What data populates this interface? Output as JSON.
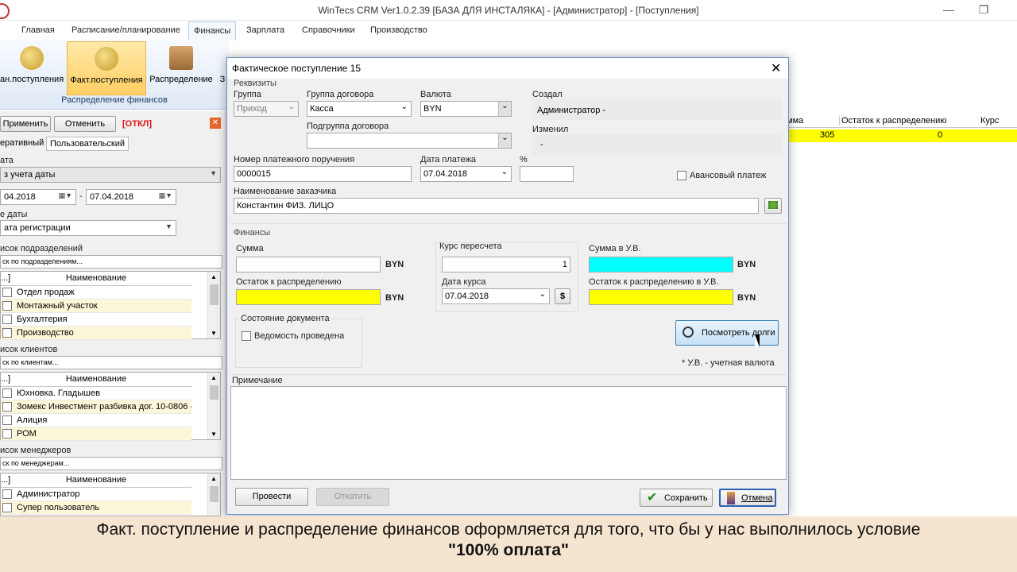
{
  "window": {
    "title": "WinTecs CRM Ver1.0.2.39 [БАЗА ДЛЯ ИНСТАЛЯКА] - [Администратор]  - [Поступления]"
  },
  "ribbon": {
    "tabs": [
      "Главная",
      "Расписание/планирование",
      "Финансы",
      "Зарплата",
      "Справочники",
      "Производство"
    ],
    "buttons": [
      "ан.поступления",
      "Факт.поступления",
      "Распределение",
      "З"
    ],
    "group_label": "Распределение финансов"
  },
  "left_panel": {
    "apply": "Применить",
    "cancel": "Отменить",
    "status": "[ОТКЛ]",
    "tabs": [
      "еративный",
      "Пользовательский"
    ],
    "date_section_label": "ата",
    "date_mode": "з учета даты",
    "date_from": "04.2018",
    "date_sep": "-",
    "date_to": "07.04.2018",
    "date_type_label": "е даты",
    "date_type": "ата регистрации",
    "departments": {
      "title": "исок подразделений",
      "search": "ск по подразделениям...",
      "col_check": "...]",
      "col_name": "Наименование",
      "rows": [
        "Отдел продаж",
        "Монтажный участок",
        "Бухгалтерия",
        "Производство"
      ]
    },
    "clients": {
      "title": "исок клиентов",
      "search": "ск по клиентам...",
      "col_check": "...]",
      "col_name": "Наименование",
      "rows": [
        "Юхновка. Гладышев",
        "Зомекс Инвестмент разбивка дог. 10-0806 -",
        "Алиция",
        "РОМ"
      ]
    },
    "managers": {
      "title": "исок менеджеров",
      "search": "ск по менеджерам...",
      "col_check": "...]",
      "col_name": "Наименование",
      "rows": [
        "Администратор",
        "Супер пользователь"
      ]
    }
  },
  "right_grid": {
    "headers": [
      "мма",
      "Остаток к распределению",
      "Курс"
    ],
    "row": [
      "305",
      "0",
      ""
    ]
  },
  "dialog": {
    "title": "Фактическое поступление 15",
    "requisites_label": "Реквизиты",
    "group_label": "Группа",
    "group_value": "Приход",
    "contract_group_label": "Группа договора",
    "contract_group_value": "Касса",
    "currency_label": "Валюта",
    "currency_value": "BYN",
    "created_label": "Создал",
    "created_value": "Администратор -",
    "contract_subgroup_label": "Подгруппа договора",
    "contract_subgroup_value": "",
    "changed_label": "Изменил",
    "changed_value": "-",
    "order_number_label": "Номер платежного поручения",
    "order_number_value": "0000015",
    "pay_date_label": "Дата платежа",
    "pay_date_value": "07.04.2018",
    "percent_label": "%",
    "percent_value": "",
    "advance_label": "Авансовый платеж",
    "customer_label": "Наименование заказчика",
    "customer_value": "Константин ФИЗ. ЛИЦО",
    "finance_label": "Финансы",
    "sum_label": "Сумма",
    "sum_value": "",
    "sum_currency": "BYN",
    "remain_label": "Остаток к распределению",
    "remain_value": "",
    "remain_currency": "BYN",
    "rate_label": "Курс пересчета",
    "rate_value": "1",
    "rate_date_label": "Дата курса",
    "rate_date_value": "07.04.2018",
    "rate_button": "$",
    "sum_uv_label": "Сумма в У.В.",
    "sum_uv_value": "",
    "sum_uv_currency": "BYN",
    "remain_uv_label": "Остаток к распределению в У.В.",
    "remain_uv_value": "",
    "remain_uv_currency": "BYN",
    "doc_state_label": "Состояние документа",
    "statement_label": "Ведомость проведена",
    "view_debts_button": "Посмотреть долги",
    "uv_note": "* У.В. - учетная валюта",
    "note_label": "Примечание",
    "note_value": "",
    "post_button": "Провести",
    "rollback_button": "Откатить",
    "save_button": "Сохранить",
    "cancel_button": "Отмена"
  },
  "caption": {
    "line1": "Факт. поступление и распределение финансов оформляется для того, что бы у нас выполнилось условие",
    "line2": "\"100% оплата\""
  }
}
